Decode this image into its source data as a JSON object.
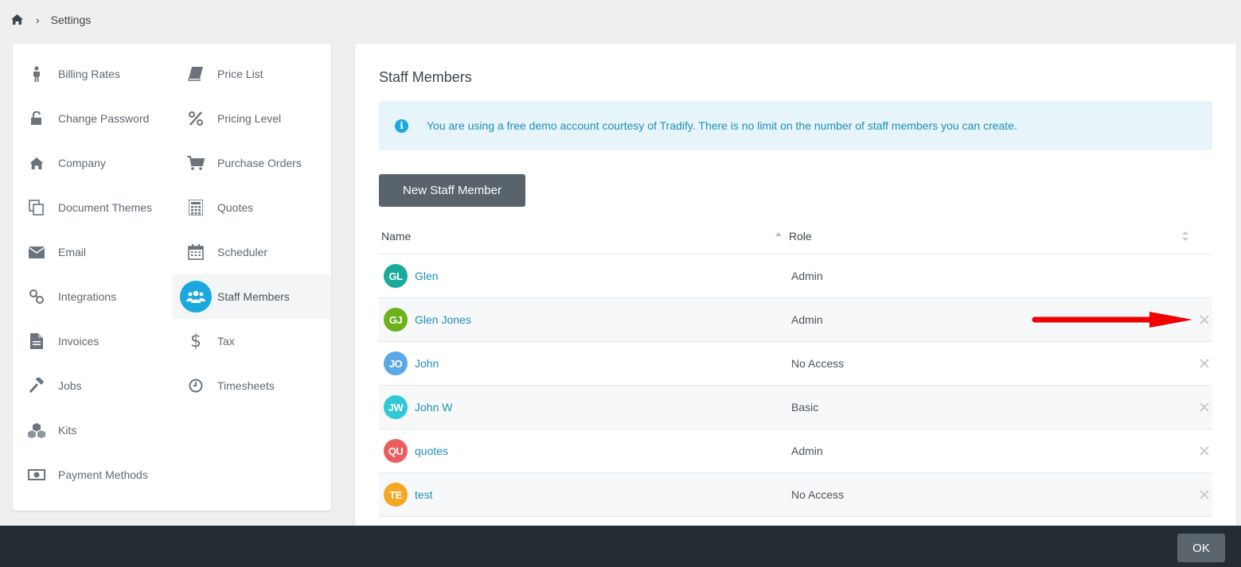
{
  "breadcrumb": {
    "home_icon": "home-icon",
    "current": "Settings"
  },
  "sidebar": {
    "left": [
      {
        "label": "Billing Rates",
        "icon": "person-icon"
      },
      {
        "label": "Change Password",
        "icon": "unlock-icon"
      },
      {
        "label": "Company",
        "icon": "home-icon"
      },
      {
        "label": "Document Themes",
        "icon": "copy-icon"
      },
      {
        "label": "Email",
        "icon": "envelope-icon"
      },
      {
        "label": "Integrations",
        "icon": "link-icon"
      },
      {
        "label": "Invoices",
        "icon": "file-icon"
      },
      {
        "label": "Jobs",
        "icon": "hammer-icon"
      },
      {
        "label": "Kits",
        "icon": "cubes-icon"
      },
      {
        "label": "Payment Methods",
        "icon": "money-icon"
      }
    ],
    "right": [
      {
        "label": "Price List",
        "icon": "book-icon"
      },
      {
        "label": "Pricing Level",
        "icon": "percent-icon"
      },
      {
        "label": "Purchase Orders",
        "icon": "cart-icon"
      },
      {
        "label": "Quotes",
        "icon": "calculator-icon"
      },
      {
        "label": "Scheduler",
        "icon": "calendar-icon"
      },
      {
        "label": "Staff Members",
        "icon": "users-icon",
        "active": true
      },
      {
        "label": "Tax",
        "icon": "dollar-icon"
      },
      {
        "label": "Timesheets",
        "icon": "clock-icon"
      }
    ]
  },
  "main": {
    "title": "Staff Members",
    "info": "You are using a free demo account courtesy of Tradify. There is no limit on the number of staff members you can create.",
    "new_button": "New Staff Member",
    "columns": {
      "name": "Name",
      "role": "Role"
    },
    "rows": [
      {
        "initials": "GL",
        "name": "Glen",
        "role": "Admin",
        "color": "#1aa99a",
        "deletable": false
      },
      {
        "initials": "GJ",
        "name": "Glen Jones",
        "role": "Admin",
        "color": "#6bb21b",
        "deletable": true
      },
      {
        "initials": "JO",
        "name": "John",
        "role": "No Access",
        "color": "#5aa9e6",
        "deletable": true
      },
      {
        "initials": "JW",
        "name": "John W",
        "role": "Basic",
        "color": "#2ec8d6",
        "deletable": true
      },
      {
        "initials": "QU",
        "name": "quotes",
        "role": "Admin",
        "color": "#ee5d5d",
        "deletable": true
      },
      {
        "initials": "TE",
        "name": "test",
        "role": "No Access",
        "color": "#f5a623",
        "deletable": true
      }
    ]
  },
  "footer": {
    "ok": "OK"
  },
  "colors": {
    "accent": "#1ba8de",
    "link": "#1f8fb8",
    "annotation_arrow": "#ee0000"
  }
}
